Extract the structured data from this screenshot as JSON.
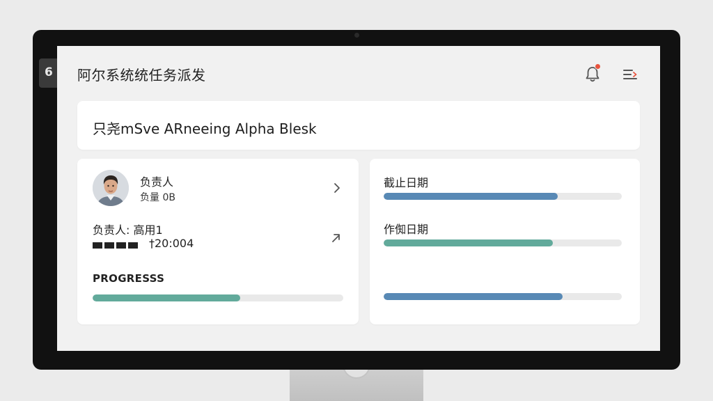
{
  "app": {
    "title": "阿尔系统统任务派发",
    "side_tab_glyph": "6"
  },
  "header": {
    "bell_icon": "bell-icon",
    "menu_icon": "menu-arrow-icon",
    "badge_color": "#e8543e"
  },
  "banner": {
    "text": "只尧mSve ARneeing Alpha Blesk"
  },
  "assignee_card": {
    "owner_label": "负责人",
    "owner_sub": "负量 0B",
    "assignee_line": "负责人:  高用1",
    "code": "†20:004",
    "progress_label": "PROGRESSS",
    "progress_value": 0.59,
    "progress_color": "#62aa9b"
  },
  "dates_card": {
    "bars": [
      {
        "label": "截止日期",
        "value": 0.73,
        "color": "#5889b5"
      },
      {
        "label": "作倁日期",
        "value": 0.71,
        "color": "#62aa9b"
      },
      {
        "label": "",
        "value": 0.75,
        "color": "#5889b5"
      }
    ]
  }
}
